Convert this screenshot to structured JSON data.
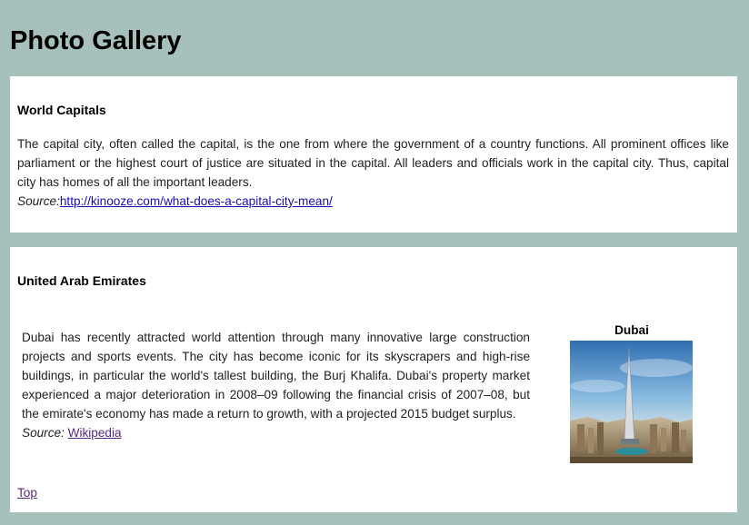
{
  "page": {
    "title": "Photo Gallery"
  },
  "world_capitals": {
    "heading": "World Capitals",
    "text": "The capital city, often called the capital, is the one from where the government of a country functions. All prominent offices like parliament or the highest court of justice are situated in the capital. All leaders and officials work in the capital city. Thus, capital city has homes of all the important leaders.",
    "source_label": "Source:",
    "source_link": "http://kinooze.com/what-does-a-capital-city-mean/"
  },
  "uae": {
    "heading": "United Arab Emirates",
    "text": "Dubai has recently attracted world attention through many innovative large construction projects and sports events. The city has become iconic for its skyscrapers and high-rise buildings, in particular the world's tallest building, the Burj Khalifa. Dubai's property market experienced a major deterioration in 2008–09 following the financial crisis of 2007–08, but the emirate's economy has made a return to growth, with a projected 2015 budget surplus.",
    "source_label": "Source:",
    "source_link": "Wikipedia",
    "figure_caption": "Dubai",
    "top_link": "Top"
  },
  "colors": {
    "background": "#a6c1bb",
    "card": "#ffffff",
    "link": "#1a0dab",
    "visited_link": "#5a2a82"
  }
}
